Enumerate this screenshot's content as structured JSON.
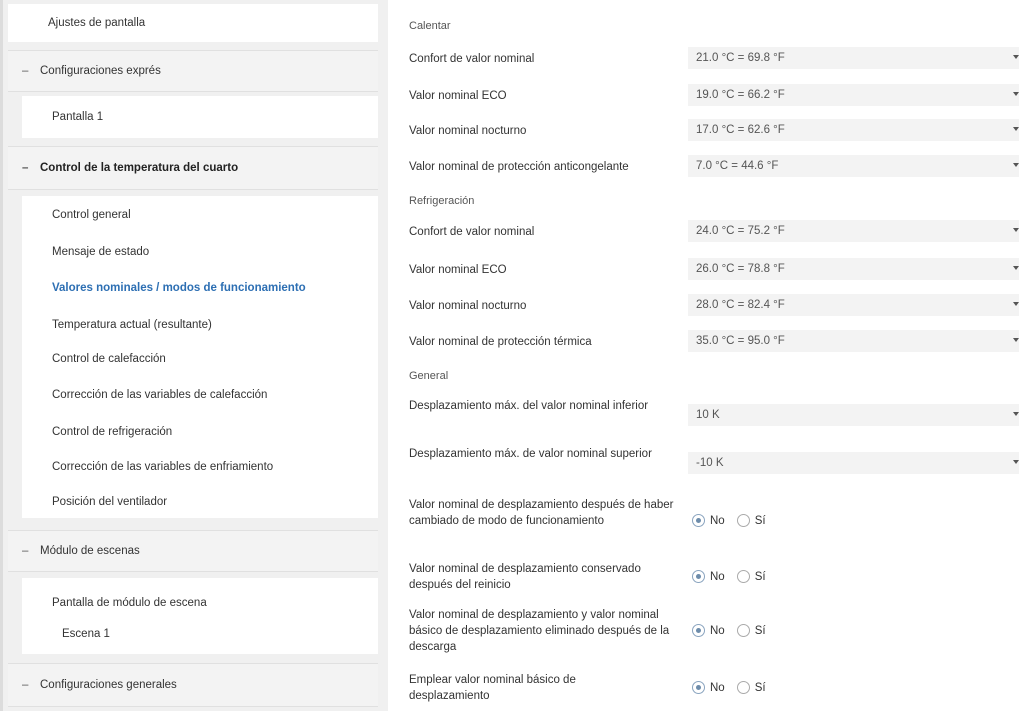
{
  "sidebar": {
    "display_settings": "Ajustes de pantalla",
    "express_settings": "Configuraciones exprés",
    "screen1": "Pantalla 1",
    "room_temp": "Control de la temperatura del cuarto",
    "room_items": [
      "Control general",
      "Mensaje de estado",
      "Valores nominales / modos de funcionamiento",
      "Temperatura actual (resultante)",
      "Control de calefacción",
      "Corrección de las variables de calefacción",
      "Control de refrigeración",
      "Corrección de las variables de enfriamiento",
      "Posición del ventilador"
    ],
    "scene_module": "Módulo de escenas",
    "scene_screen": "Pantalla de módulo de escena",
    "scene1": "Escena 1",
    "general_settings": "Configuraciones generales",
    "minus": "–"
  },
  "main": {
    "heat_title": "Calentar",
    "heat": [
      {
        "label": "Confort de valor nominal",
        "value": "21.0 °C = 69.8 °F"
      },
      {
        "label": "Valor nominal ECO",
        "value": "19.0 °C = 66.2 °F"
      },
      {
        "label": "Valor nominal nocturno",
        "value": "17.0 °C = 62.6 °F"
      },
      {
        "label": "Valor nominal de protección anticongelante",
        "value": "7.0 °C = 44.6 °F"
      }
    ],
    "cool_title": "Refrigeración",
    "cool": [
      {
        "label": "Confort de valor nominal",
        "value": "24.0 °C = 75.2 °F"
      },
      {
        "label": "Valor nominal ECO",
        "value": "26.0 °C = 78.8 °F"
      },
      {
        "label": "Valor nominal nocturno",
        "value": "28.0 °C = 82.4 °F"
      },
      {
        "label": "Valor nominal de protección térmica",
        "value": "35.0 °C = 95.0 °F"
      }
    ],
    "general_title": "General",
    "general": [
      {
        "label": "Desplazamiento máx. del valor nominal inferior",
        "value": "10 K"
      },
      {
        "label": "Desplazamiento máx. de valor nominal superior",
        "value": "-10 K"
      }
    ],
    "radios": [
      {
        "label": "Valor nominal de desplazamiento después de haber cambiado de modo de funcionamiento",
        "no": "No",
        "yes": "Sí",
        "selected": "No"
      },
      {
        "label": "Valor nominal de desplazamiento conservado después del reinicio",
        "no": "No",
        "yes": "Sí",
        "selected": "No"
      },
      {
        "label": "Valor nominal de desplazamiento y valor nominal básico de desplazamiento eliminado después de la descarga",
        "no": "No",
        "yes": "Sí",
        "selected": "No"
      },
      {
        "label": "Emplear valor nominal básico de desplazamiento",
        "no": "No",
        "yes": "Sí",
        "selected": "No"
      }
    ]
  }
}
